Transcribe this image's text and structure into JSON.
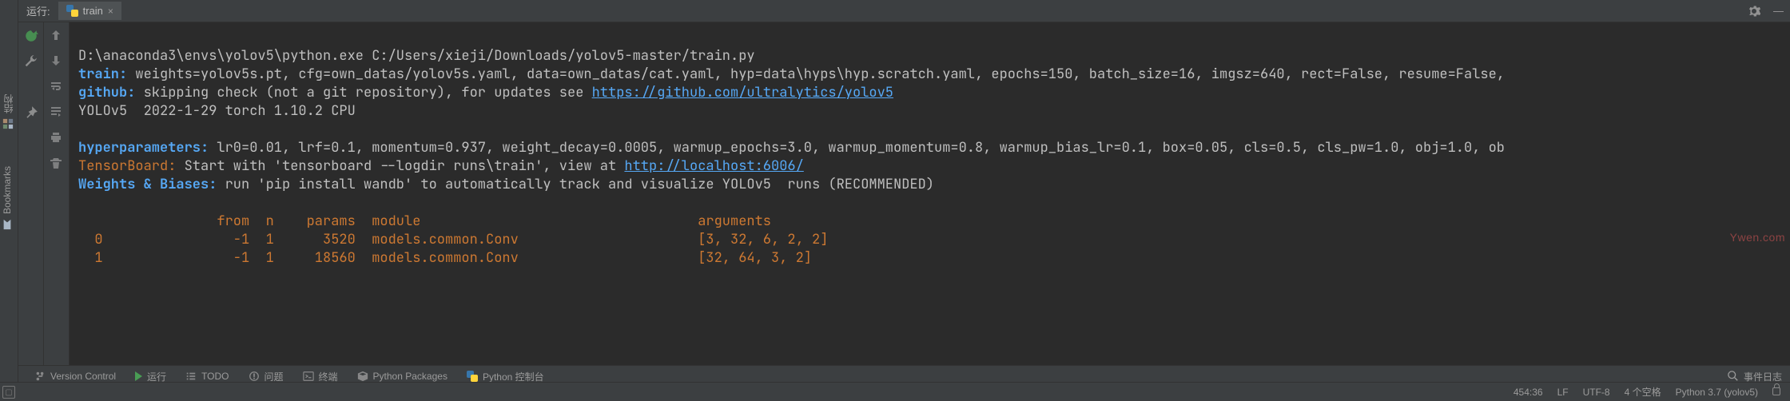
{
  "left_rail": {
    "bookmarks": "Bookmarks",
    "structure": "结构"
  },
  "run_header": {
    "label": "运行:",
    "tab_name": "train"
  },
  "console": {
    "exec_line": "D:\\anaconda3\\envs\\yolov5\\python.exe C:/Users/xieji/Downloads/yolov5-master/train.py",
    "train_key": "train:",
    "train_val": " weights=yolov5s.pt, cfg=own_datas/yolov5s.yaml, data=own_datas/cat.yaml, hyp=data\\hyps\\hyp.scratch.yaml, epochs=150, batch_size=16, imgsz=640, rect=False, resume=False,",
    "github_key": "github:",
    "github_val_pre": " skipping check (not a git repository), for updates see ",
    "github_link": "https://github.com/ultralytics/yolov5",
    "yolo_line": "YOLOv5  2022-1-29 torch 1.10.2 CPU",
    "hyper_key": "hyperparameters:",
    "hyper_val": " lr0=0.01, lrf=0.1, momentum=0.937, weight_decay=0.0005, warmup_epochs=3.0, warmup_momentum=0.8, warmup_bias_lr=0.1, box=0.05, cls=0.5, cls_pw=1.0, obj=1.0, ob",
    "tb_key": "TensorBoard:",
    "tb_val_pre": " Start with 'tensorboard --logdir runs\\train', view at ",
    "tb_link": "http://localhost:6006/",
    "wb_key": "Weights & Biases:",
    "wb_val": " run 'pip install wandb' to automatically track and visualize YOLOv5  runs (RECOMMENDED)",
    "table_header": "                 from  n    params  module                                  arguments",
    "table_row0": "  0                -1  1      3520  models.common.Conv                      [3, 32, 6, 2, 2]",
    "table_row1": "  1                -1  1     18560  models.common.Conv                      [32, 64, 3, 2]"
  },
  "bottom_bar": {
    "version_control": "Version Control",
    "run": "运行",
    "todo": "TODO",
    "problems": "问题",
    "terminal": "终端",
    "py_packages": "Python Packages",
    "py_console": "Python 控制台",
    "event_log": "事件日志"
  },
  "status_bar": {
    "cursor": "454:36",
    "line_sep": "LF",
    "encoding": "UTF-8",
    "indent": "4 个空格",
    "interpreter": "Python 3.7 (yolov5)"
  },
  "watermark": "Ywen.com"
}
